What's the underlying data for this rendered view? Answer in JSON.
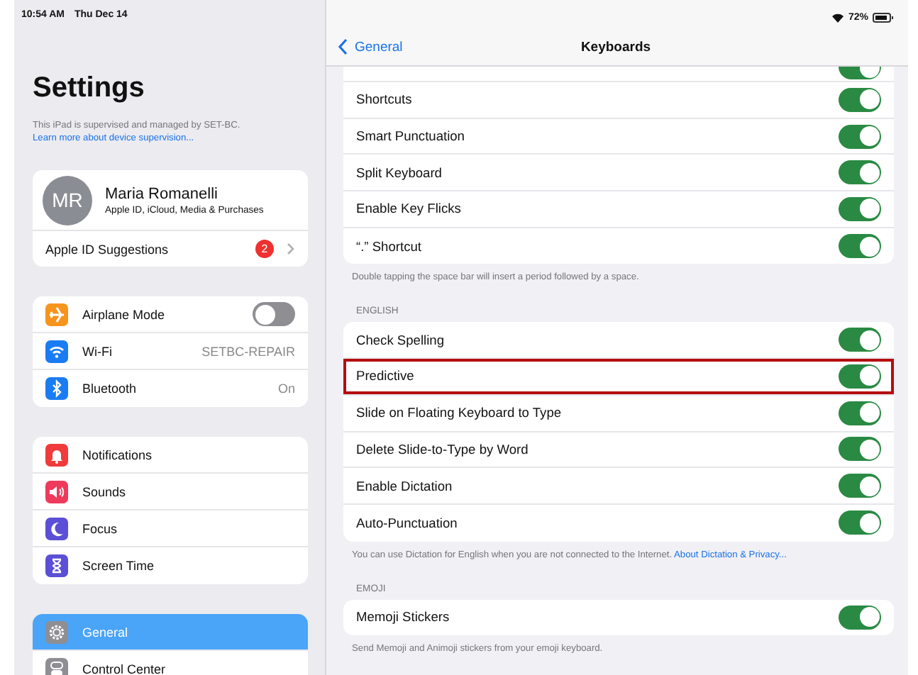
{
  "status_bar": {
    "time": "10:54 AM",
    "date": "Thu Dec 14",
    "battery": "72%"
  },
  "sidebar": {
    "title": "Settings",
    "supervision_note": "This iPad is supervised and managed by SET-BC.",
    "supervision_link": "Learn more about device supervision...",
    "profile": {
      "initials": "MR",
      "name": "Maria Romanelli",
      "subtitle": "Apple ID, iCloud, Media & Purchases"
    },
    "suggestions": {
      "label": "Apple ID Suggestions",
      "badge": "2"
    },
    "groups": [
      [
        {
          "label": "Airplane Mode",
          "color": "#f7941d",
          "kind": "toggle",
          "on": false,
          "selected": false
        },
        {
          "label": "Wi-Fi",
          "color": "#1a7cf2",
          "kind": "value",
          "value": "SETBC-REPAIR",
          "selected": false
        },
        {
          "label": "Bluetooth",
          "color": "#1a7cf2",
          "kind": "value",
          "value": "On",
          "selected": false
        }
      ],
      [
        {
          "label": "Notifications",
          "color": "#ef3b3b",
          "kind": "plain",
          "selected": false
        },
        {
          "label": "Sounds",
          "color": "#ee3a5c",
          "kind": "plain",
          "selected": false
        },
        {
          "label": "Focus",
          "color": "#5b4fd6",
          "kind": "plain",
          "selected": false
        },
        {
          "label": "Screen Time",
          "color": "#5b4fd6",
          "kind": "plain",
          "selected": false
        }
      ],
      [
        {
          "label": "General",
          "color": "#8e8e93",
          "kind": "plain",
          "selected": true
        },
        {
          "label": "Control Center",
          "color": "#8e8e93",
          "kind": "plain",
          "selected": false
        }
      ]
    ]
  },
  "detail": {
    "back": "General",
    "title": "Keyboards",
    "sections": [
      {
        "rows": [
          {
            "on": true
          },
          {
            "label": "Shortcuts",
            "on": true,
            "highlighted": false
          },
          {
            "label": "Smart Punctuation",
            "on": true,
            "highlighted": false
          },
          {
            "label": "Split Keyboard",
            "on": true,
            "highlighted": false
          },
          {
            "label": "Enable Key Flicks",
            "on": true,
            "highlighted": false
          },
          {
            "label": "“.” Shortcut",
            "on": true,
            "highlighted": false
          }
        ],
        "footer": "Double tapping the space bar will insert a period followed by a space."
      },
      {
        "header": "ENGLISH",
        "rows": [
          {
            "label": "Check Spelling",
            "on": true,
            "highlighted": false
          },
          {
            "label": "Predictive",
            "on": true,
            "highlighted": true
          },
          {
            "label": "Slide on Floating Keyboard to Type",
            "on": true,
            "highlighted": false
          },
          {
            "label": "Delete Slide-to-Type by Word",
            "on": true,
            "highlighted": false
          },
          {
            "label": "Enable Dictation",
            "on": true,
            "highlighted": false
          },
          {
            "label": "Auto-Punctuation",
            "on": true,
            "highlighted": false
          }
        ],
        "footer": "You can use Dictation for English when you are not connected to the Internet.",
        "footer_link": "About Dictation & Privacy..."
      },
      {
        "header": "EMOJI",
        "rows": [
          {
            "label": "Memoji Stickers",
            "on": true,
            "highlighted": false
          }
        ],
        "footer": "Send Memoji and Animoji stickers from your emoji keyboard."
      }
    ]
  }
}
